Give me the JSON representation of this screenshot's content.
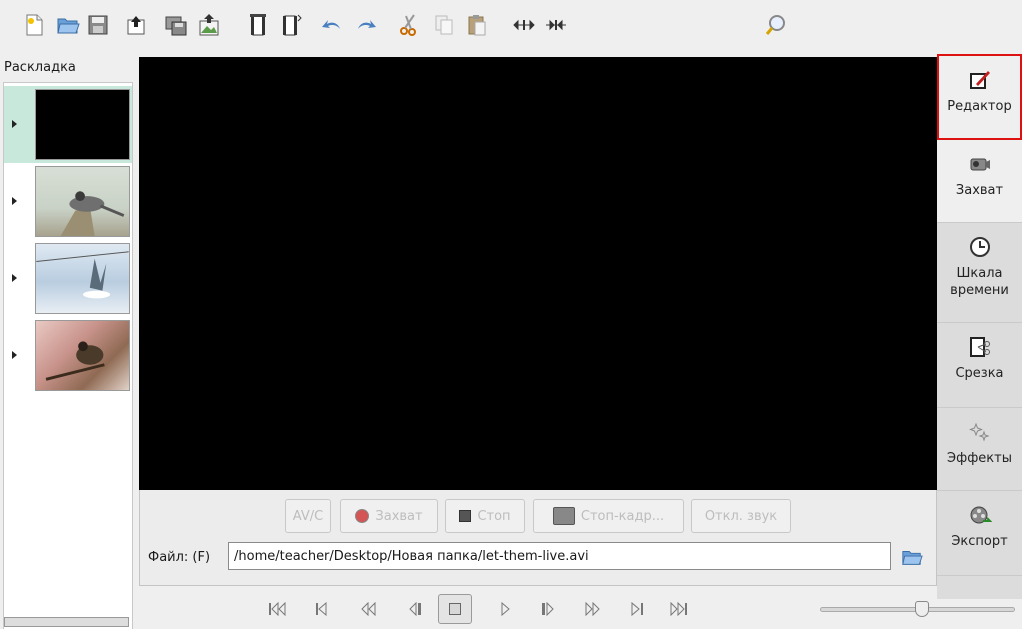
{
  "toolbar": {
    "icons": [
      "new-file-icon",
      "open-folder-icon",
      "save-icon",
      "export-icon",
      "save-frame-icon",
      "publish-icon",
      "split-scene-icon",
      "join-scene-icon",
      "undo-icon",
      "redo-icon",
      "cut-icon",
      "copy-icon",
      "paste-icon",
      "expand-icon",
      "collapse-icon",
      "search-icon"
    ]
  },
  "sidebar": {
    "title": "Раскладка",
    "items": [
      {
        "thumb": "black",
        "active": true
      },
      {
        "thumb": "bird-branch",
        "active": false
      },
      {
        "thumb": "bird-snow",
        "active": false
      },
      {
        "thumb": "bird-flowers",
        "active": false
      }
    ]
  },
  "capture": {
    "avc_label": "AV/C",
    "capture_label": "Захват",
    "stop_label": "Стоп",
    "still_label": "Стоп-кадр...",
    "mute_label": "Откл. звук"
  },
  "file": {
    "label": "Файл: (F)",
    "path": "/home/teacher/Desktop/Новая папка/let-them-live.avi"
  },
  "modes": {
    "editor": "Редактор",
    "capture": "Захват",
    "timeline_1": "Шкала",
    "timeline_2": "времени",
    "trim": "Срезка",
    "effects": "Эффекты",
    "export": "Экспорт"
  },
  "transport": {
    "buttons": [
      "first-scene-icon",
      "previous-scene-icon",
      "rewind-icon",
      "previous-frame-icon",
      "stop-icon",
      "play-icon",
      "next-frame-icon",
      "fast-forward-icon",
      "next-scene-icon",
      "last-scene-icon"
    ]
  },
  "colors": {
    "active_tab_border": "#dd1111",
    "storyboard_selection": "#c8e8dc",
    "monitor_bg": "#000000"
  }
}
